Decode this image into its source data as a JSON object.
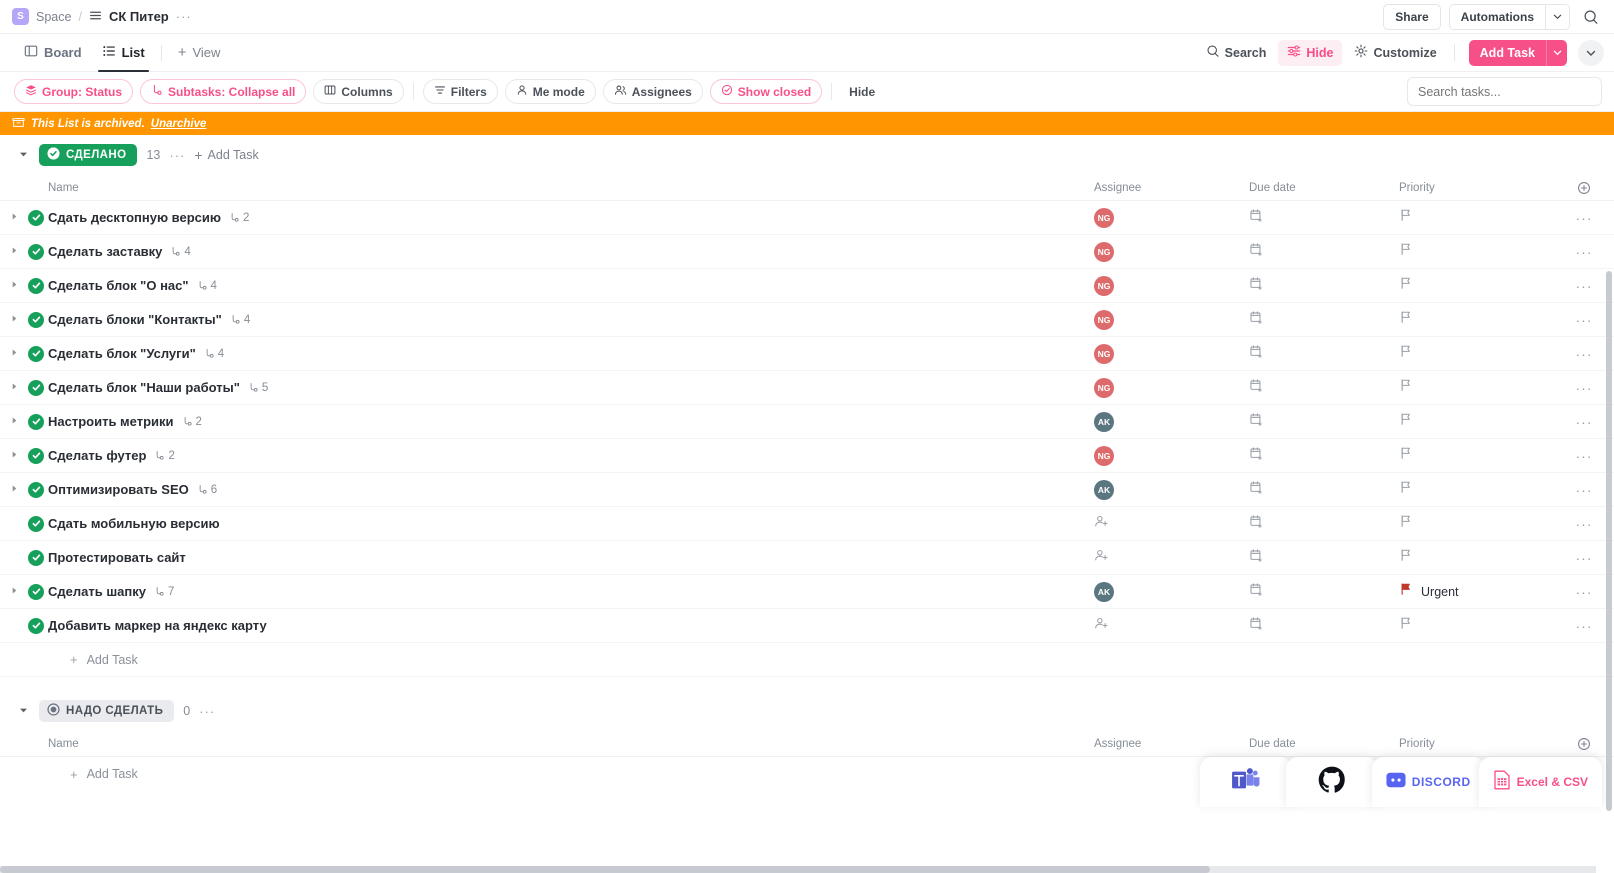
{
  "topbar": {
    "space_initial": "S",
    "space_label": "Space",
    "separator": "/",
    "list_title": "СК Питер",
    "more_dots": "···",
    "share_label": "Share",
    "automations_label": "Automations",
    "automations_caret": "⌄",
    "search_icon": "search-icon"
  },
  "views": {
    "tabs": [
      {
        "label": "Board",
        "icon": "board-icon",
        "active": false
      },
      {
        "label": "List",
        "icon": "list-icon",
        "active": true
      }
    ],
    "add_view_label": "View",
    "add_view_plus": "+",
    "tools": [
      {
        "label": "Search",
        "icon": "search-icon",
        "pink": false
      },
      {
        "label": "Hide",
        "icon": "sliders-icon",
        "pink": true
      },
      {
        "label": "Customize",
        "icon": "gear-icon",
        "pink": false
      }
    ],
    "add_task_label": "Add Task",
    "add_task_caret": "⌄",
    "collapse_caret": "⌄"
  },
  "filters": {
    "chips": [
      {
        "label": "Group: Status",
        "icon": "layers-icon",
        "pink": true
      },
      {
        "label": "Subtasks: Collapse all",
        "icon": "subtask-icon",
        "pink": true
      },
      {
        "label": "Columns",
        "icon": "columns-icon",
        "pink": false
      },
      {
        "label": "Filters",
        "icon": "filter-icon",
        "pink": false
      },
      {
        "label": "Me mode",
        "icon": "person-icon",
        "pink": false
      },
      {
        "label": "Assignees",
        "icon": "people-icon",
        "pink": false
      },
      {
        "label": "Show closed",
        "icon": "check-circle-icon",
        "pink": true
      }
    ],
    "hide_label": "Hide",
    "search_placeholder": "Search tasks..."
  },
  "archive_banner": {
    "icon": "archive-icon",
    "message": "This List is archived.",
    "action_label": "Unarchive",
    "color": "#ff9500"
  },
  "columns": {
    "name": "Name",
    "assignee": "Assignee",
    "due_date": "Due date",
    "priority": "Priority",
    "add_column_icon": "plus-circle-icon"
  },
  "colors": {
    "done_green": "#17a05b",
    "todo_gray": "#e9ebee",
    "avatar_ng": "#dd6b6b",
    "avatar_ak": "#5a7680",
    "urgent_red": "#c0392b",
    "accent_pink": "#f74f87",
    "banner_orange": "#ff9500"
  },
  "groups": [
    {
      "name": "СДЕЛАНО",
      "style": "done",
      "status_icon": "check-circle-icon",
      "count": "13",
      "dots": "···",
      "add_task_label": "Add Task",
      "add_task_row_label": "Add Task",
      "tasks": [
        {
          "name": "Сдать десктопную версию",
          "subtasks": "2",
          "expandable": true,
          "assignee": "NG",
          "assignee_color": "#dd6b6b",
          "due": "",
          "priority": "",
          "priority_color": ""
        },
        {
          "name": "Сделать заставку",
          "subtasks": "4",
          "expandable": true,
          "assignee": "NG",
          "assignee_color": "#dd6b6b",
          "due": "",
          "priority": "",
          "priority_color": ""
        },
        {
          "name": "Сделать блок \"О нас\"",
          "subtasks": "4",
          "expandable": true,
          "assignee": "NG",
          "assignee_color": "#dd6b6b",
          "due": "",
          "priority": "",
          "priority_color": ""
        },
        {
          "name": "Сделать блоки \"Контакты\"",
          "subtasks": "4",
          "expandable": true,
          "assignee": "NG",
          "assignee_color": "#dd6b6b",
          "due": "",
          "priority": "",
          "priority_color": ""
        },
        {
          "name": "Сделать блок \"Услуги\"",
          "subtasks": "4",
          "expandable": true,
          "assignee": "NG",
          "assignee_color": "#dd6b6b",
          "due": "",
          "priority": "",
          "priority_color": ""
        },
        {
          "name": "Сделать блок \"Наши работы\"",
          "subtasks": "5",
          "expandable": true,
          "assignee": "NG",
          "assignee_color": "#dd6b6b",
          "due": "",
          "priority": "",
          "priority_color": ""
        },
        {
          "name": "Настроить метрики",
          "subtasks": "2",
          "expandable": true,
          "assignee": "AK",
          "assignee_color": "#5a7680",
          "due": "",
          "priority": "",
          "priority_color": ""
        },
        {
          "name": "Сделать футер",
          "subtasks": "2",
          "expandable": true,
          "assignee": "NG",
          "assignee_color": "#dd6b6b",
          "due": "",
          "priority": "",
          "priority_color": ""
        },
        {
          "name": "Оптимизировать SEO",
          "subtasks": "6",
          "expandable": true,
          "assignee": "AK",
          "assignee_color": "#5a7680",
          "due": "",
          "priority": "",
          "priority_color": ""
        },
        {
          "name": "Сдать мобильную версию",
          "subtasks": "",
          "expandable": false,
          "assignee": "",
          "assignee_color": "",
          "due": "",
          "priority": "",
          "priority_color": ""
        },
        {
          "name": "Протестировать сайт",
          "subtasks": "",
          "expandable": false,
          "assignee": "",
          "assignee_color": "",
          "due": "",
          "priority": "",
          "priority_color": ""
        },
        {
          "name": "Сделать шапку",
          "subtasks": "7",
          "expandable": true,
          "assignee": "AK",
          "assignee_color": "#5a7680",
          "due": "",
          "priority": "Urgent",
          "priority_color": "#c0392b"
        },
        {
          "name": "Добавить маркер на яндекс карту",
          "subtasks": "",
          "expandable": false,
          "assignee": "",
          "assignee_color": "",
          "due": "",
          "priority": "",
          "priority_color": ""
        }
      ]
    },
    {
      "name": "НАДО СДЕЛАТЬ",
      "style": "todo",
      "status_icon": "circle-icon",
      "count": "0",
      "dots": "···",
      "add_task_label": "Add Task",
      "add_task_row_label": "Add Task",
      "tasks": []
    }
  ],
  "integrations": [
    {
      "name": "Microsoft Teams",
      "icon": "teams-icon",
      "label": ""
    },
    {
      "name": "GitHub",
      "icon": "github-icon",
      "label": ""
    },
    {
      "name": "Discord",
      "icon": "discord-icon",
      "label": "DISCORD"
    },
    {
      "name": "Excel & CSV",
      "icon": "excel-icon",
      "label": "Excel & CSV"
    }
  ]
}
